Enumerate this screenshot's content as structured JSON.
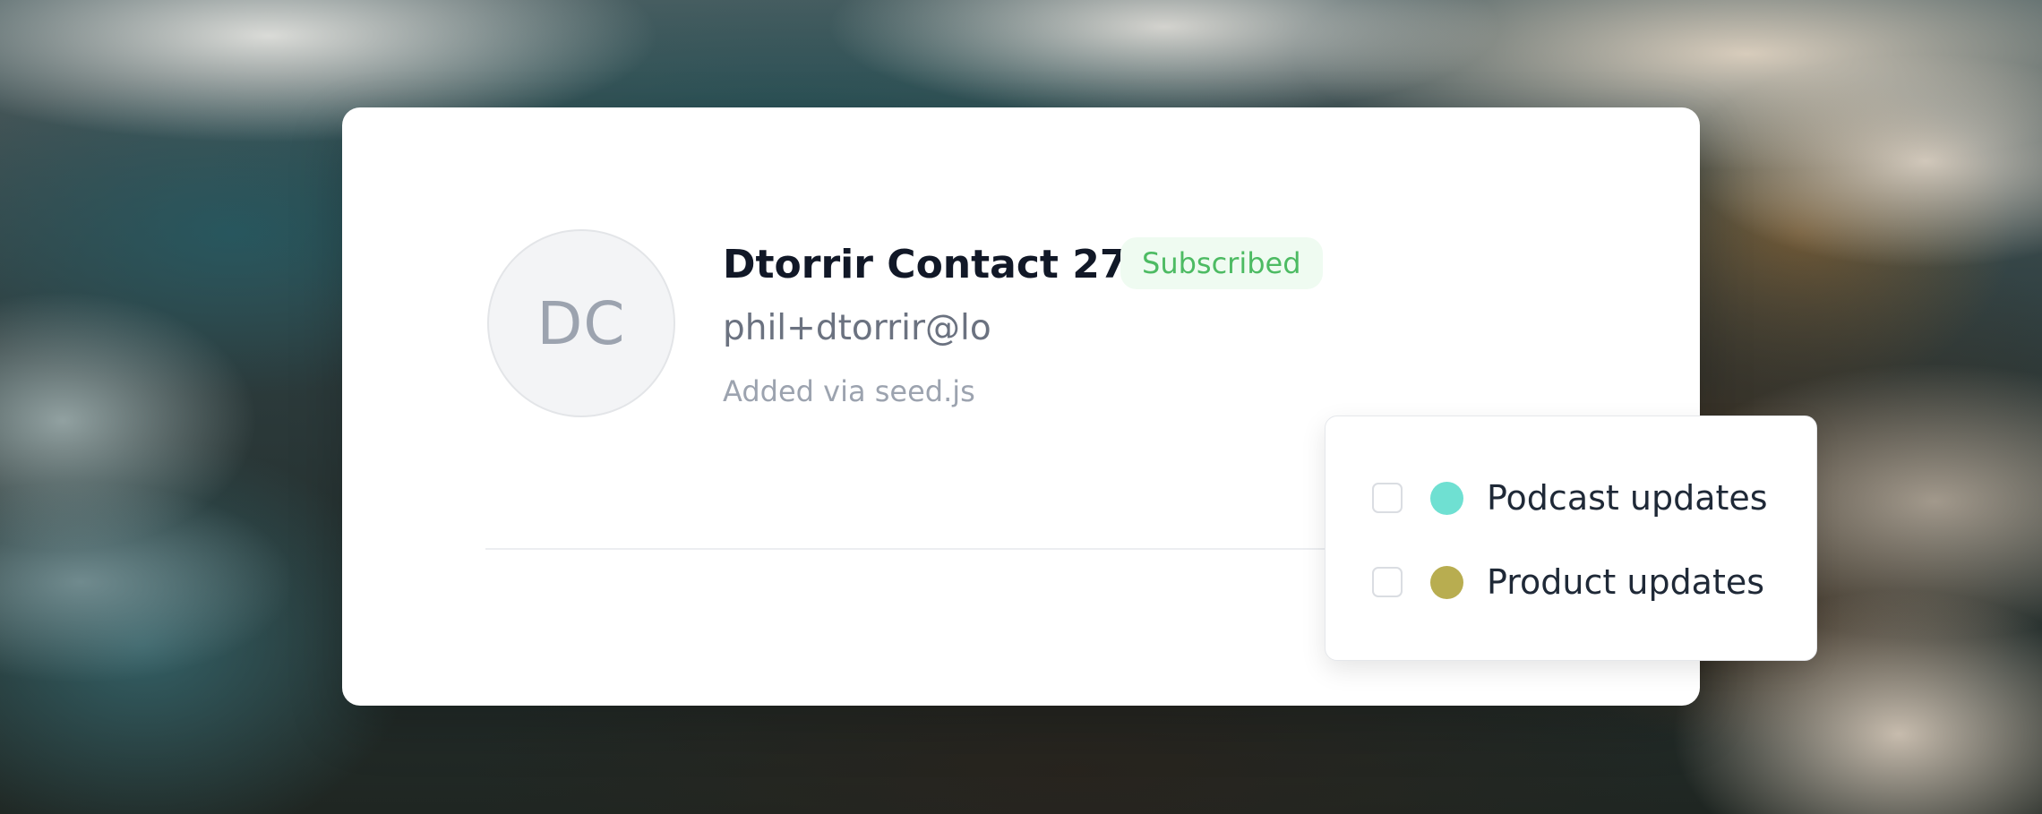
{
  "contact": {
    "initials": "DC",
    "name": "Dtorrir Contact 27",
    "status": "Subscribed",
    "email": "phil+dtorrir@lo",
    "source": "Added via seed.js"
  },
  "dropdown": {
    "items": [
      {
        "label": "Podcast updates",
        "color": "#6fe0d2",
        "checked": false
      },
      {
        "label": "Product updates",
        "color": "#b8ad50",
        "checked": false
      }
    ]
  },
  "colors": {
    "status_text": "#4dbb63",
    "status_bg": "#effbf1"
  }
}
